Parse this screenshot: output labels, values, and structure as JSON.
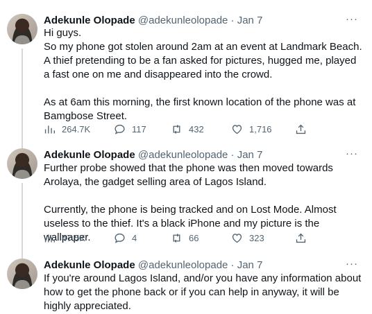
{
  "tweets": [
    {
      "name": "Adekunle Olopade",
      "handle": "@adekunleolopade",
      "separator": "·",
      "date": "Jan 7",
      "more": "···",
      "text": "Hi guys.\nSo my phone got stolen around 2am at an event at Landmark Beach. A thief pretending to be a fan asked for pictures, hugged me, played a fast one on me and disappeared into the crowd.\n\nAs at 6am this morning, the first known location of the phone was at Bamgbose Street.",
      "views": "264.7K",
      "replies": "117",
      "retweets": "432",
      "likes": "1,716"
    },
    {
      "name": "Adekunle Olopade",
      "handle": "@adekunleolopade",
      "separator": "·",
      "date": "Jan 7",
      "more": "···",
      "text": "Further probe showed that the phone was then moved towards Arolaya, the gadget selling area of Lagos Island.\n\nCurrently, the phone is being tracked and on Lost Mode. Almost useless to the thief. It's a black iPhone and my picture is the wallpaper.",
      "views": "47.5K",
      "replies": "4",
      "retweets": "66",
      "likes": "323"
    },
    {
      "name": "Adekunle Olopade",
      "handle": "@adekunleolopade",
      "separator": "·",
      "date": "Jan 7",
      "more": "···",
      "text": "If you're around Lagos Island, and/or you have any information about how to get the phone back or if you can help in anyway, it will be highly appreciated."
    }
  ],
  "icons": {
    "views": "bar-chart-icon",
    "reply": "speech-bubble-icon",
    "retweet": "retweet-arrows-icon",
    "like": "heart-icon",
    "share": "share-upload-icon"
  },
  "colors": {
    "text": "#0f1419",
    "secondary": "#536471",
    "thread_line": "#cfd9de"
  }
}
